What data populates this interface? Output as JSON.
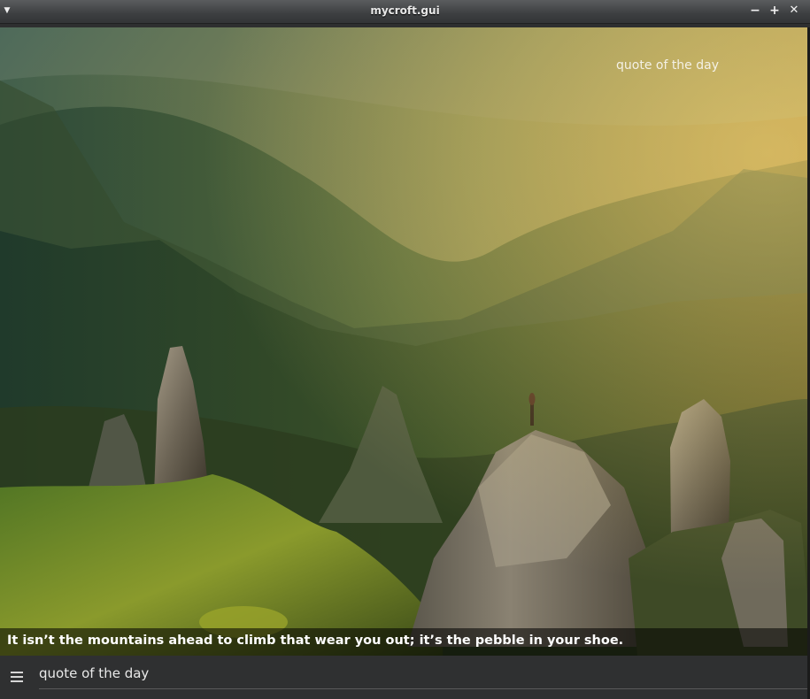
{
  "window": {
    "title": "mycroft.gui",
    "menu_icon": "chevron-down-icon",
    "minimize_icon": "minus-icon",
    "maximize_icon": "plus-icon",
    "close_icon": "close-icon"
  },
  "quote": {
    "heading": "quote of the day",
    "text": "It isn’t the mountains ahead to climb that wear you out; it’s the pebble in your shoe."
  },
  "bottom_bar": {
    "menu_icon": "hamburger-menu-icon",
    "label": "quote of the day"
  }
}
